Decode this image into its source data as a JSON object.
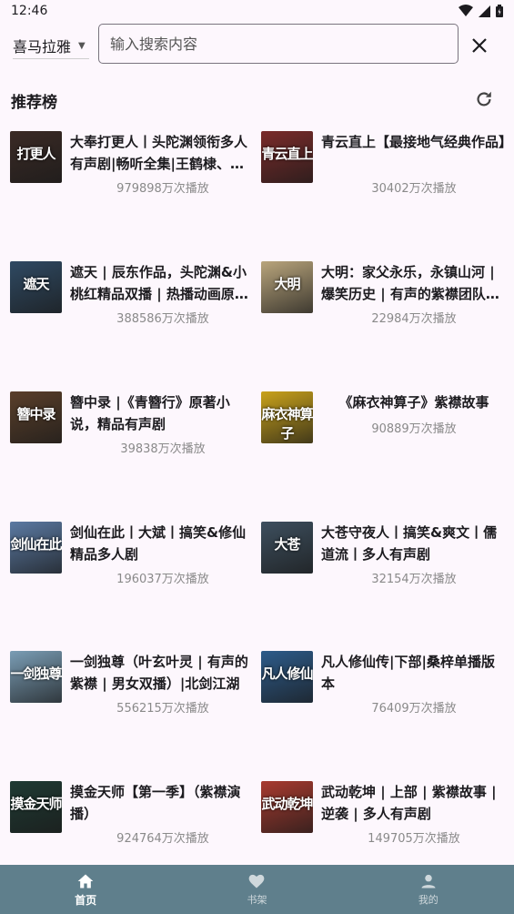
{
  "status": {
    "time": "12:46",
    "icons": [
      "wifi-icon",
      "signal-icon",
      "battery-icon"
    ]
  },
  "search": {
    "source": "喜马拉雅",
    "placeholder": "输入搜索内容",
    "value": ""
  },
  "section": {
    "title": "推荐榜"
  },
  "books": [
    {
      "title": "大奉打更人丨头陀渊领衔多人有声剧|畅听全集|王鹤棣、…",
      "plays": "979898万次播放",
      "cover_text": "打更人",
      "cover_color": "#3a2a25"
    },
    {
      "title": "青云直上【最接地气经典作品】",
      "plays": "30402万次播放",
      "cover_text": "青云直上",
      "cover_color": "#7a2b2a"
    },
    {
      "title": "遮天 | 辰东作品，头陀渊&小桃红精品双播 | 热播动画原…",
      "plays": "388586万次播放",
      "cover_text": "遮天",
      "cover_color": "#2f4a63"
    },
    {
      "title": "大明：家父永乐，永镇山河 | 爆笑历史 | 有声的紫襟团队…",
      "plays": "22984万次播放",
      "cover_text": "大明",
      "cover_color": "#b9a57c"
    },
    {
      "title": "簪中录 |《青簪行》原著小说，精品有声剧",
      "plays": "39838万次播放",
      "cover_text": "簪中录",
      "cover_color": "#5a3f2a"
    },
    {
      "title": "《麻衣神算子》紫襟故事",
      "plays": "90889万次播放",
      "cover_text": "麻衣神算子",
      "cover_color": "#c9a21a"
    },
    {
      "title": "剑仙在此丨大斌丨搞笑&修仙精品多人剧",
      "plays": "196037万次播放",
      "cover_text": "剑仙在此",
      "cover_color": "#5b7aa3"
    },
    {
      "title": "大苍守夜人丨搞笑&爽文丨儒道流丨多人有声剧",
      "plays": "32154万次播放",
      "cover_text": "大苍",
      "cover_color": "#3d4f5e"
    },
    {
      "title": "一剑独尊（叶玄叶灵 | 有声的紫襟 | 男女双播）|北剑江湖",
      "plays": "556215万次播放",
      "cover_text": "一剑独尊",
      "cover_color": "#7a9db5"
    },
    {
      "title": "凡人修仙传|下部|桑梓单播版本",
      "plays": "76409万次播放",
      "cover_text": "凡人修仙",
      "cover_color": "#2d5b8a"
    },
    {
      "title": "摸金天师【第一季】（紫襟演播）",
      "plays": "924764万次播放",
      "cover_text": "摸金天师",
      "cover_color": "#1f3a33"
    },
    {
      "title": "武动乾坤 | 上部 | 紫襟故事 | 逆袭 | 多人有声剧",
      "plays": "149705万次播放",
      "cover_text": "武动乾坤",
      "cover_color": "#a83a2f"
    }
  ],
  "nav": [
    {
      "label": "首页",
      "icon": "home-icon",
      "active": true
    },
    {
      "label": "书架",
      "icon": "heart-icon",
      "active": false
    },
    {
      "label": "我的",
      "icon": "person-icon",
      "active": false
    }
  ]
}
